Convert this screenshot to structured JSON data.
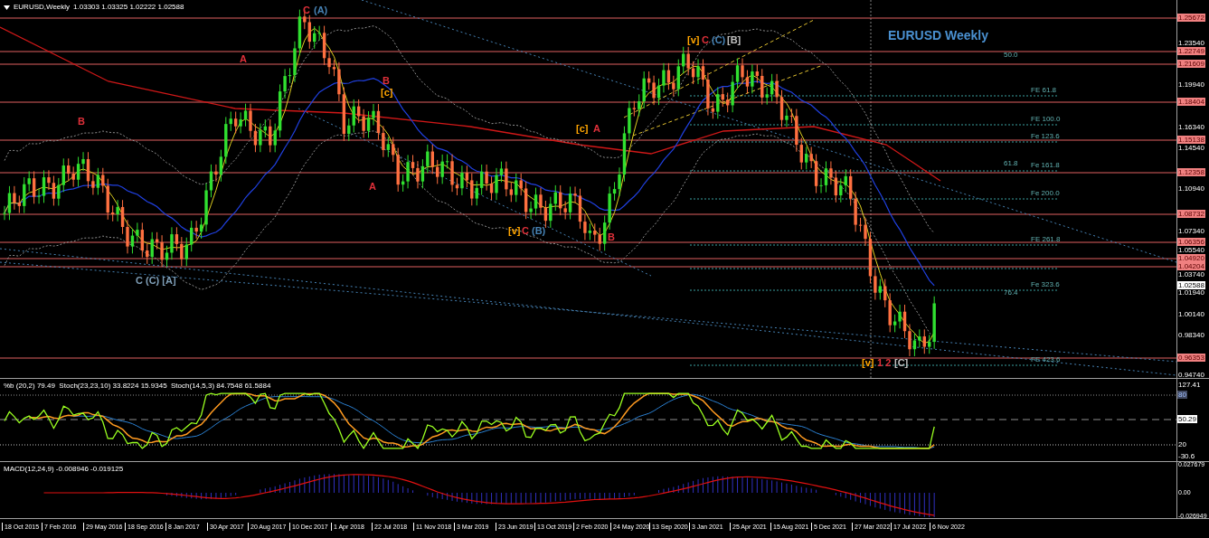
{
  "header": {
    "symbol": "EURUSD,Weekly",
    "ohlc": "1.03303 1.03325 1.02222 1.02588"
  },
  "chart_title": "EURUSD Weekly",
  "price_axis": {
    "ticks": [
      "1.23540",
      "1.19940",
      "1.16340",
      "1.14540",
      "1.10940",
      "1.07340",
      "1.05540",
      "1.03740",
      "1.01940",
      "1.00140",
      "0.98340",
      "0.94740"
    ],
    "levels": [
      "1.25672",
      "1.22749",
      "1.21609",
      "1.18404",
      "1.15138",
      "1.12358",
      "1.08732",
      "1.06356",
      "1.04920",
      "1.04204",
      "0.96353"
    ],
    "current_price": "1.02588"
  },
  "fib_labels": [
    "50.0",
    "FE 61.8",
    "FE 100.0",
    "Fe 123.6",
    "61.8",
    "Fe 161.8",
    "Fe 200.0",
    "FE 261.8",
    "Fe 323.6",
    "76.4",
    "FE 423.6"
  ],
  "wave_labels": [
    {
      "text": "C",
      "color": "#e0303a"
    },
    {
      "text": "(A)",
      "color": "#4682b4"
    },
    {
      "text": "A",
      "color": "#e0303a"
    },
    {
      "text": "B",
      "color": "#e0303a"
    },
    {
      "text": "B",
      "color": "#e0303a"
    },
    {
      "text": "[c]",
      "color": "#ffa500"
    },
    {
      "text": "A",
      "color": "#e0303a"
    },
    {
      "text": "C (C) [A]",
      "color": "#7f9fb8"
    },
    {
      "text": "[v]",
      "color": "#ffa500"
    },
    {
      "text": "C",
      "color": "#e0303a"
    },
    {
      "text": "(B)",
      "color": "#4682b4"
    },
    {
      "text": "[c]",
      "color": "#ffa500"
    },
    {
      "text": "A",
      "color": "#e0303a"
    },
    {
      "text": "B",
      "color": "#e0303a"
    },
    {
      "text": "[v]",
      "color": "#ffa500"
    },
    {
      "text": "C",
      "color": "#e0303a"
    },
    {
      "text": "(C)",
      "color": "#4682b4"
    },
    {
      "text": "[B]",
      "color": "#c0c0c0"
    },
    {
      "text": "[v]",
      "color": "#ffa500"
    },
    {
      "text": "1 2",
      "color": "#e0303a"
    },
    {
      "text": "[C]",
      "color": "#c0c0c0"
    }
  ],
  "oscillator": {
    "legend": "%b (20,2) 79.49  Stoch(23,23,10) 33.8224 15.9345  Stoch(14,5,3) 84.7548 61.5884",
    "ticks": [
      "127.41",
      "20",
      "-30.6"
    ],
    "boxed_ticks": [
      "80",
      "50.29"
    ]
  },
  "macd": {
    "legend": "MACD(12,24,9) -0.008946 -0.019125",
    "ticks": [
      "0.027679",
      "0.00",
      "-0.026949"
    ]
  },
  "date_axis": [
    "18 Oct 2015",
    "7 Feb 2016",
    "29 May 2016",
    "18 Sep 2016",
    "8 Jan 2017",
    "30 Apr 2017",
    "20 Aug 2017",
    "10 Dec 2017",
    "1 Apr 2018",
    "22 Jul 2018",
    "11 Nov 2018",
    "3 Mar 2019",
    "23 Jun 2019",
    "13 Oct 2019",
    "2 Feb 2020",
    "24 May 2020",
    "13 Sep 2020",
    "3 Jan 2021",
    "25 Apr 2021",
    "15 Aug 2021",
    "5 Dec 2021",
    "27 Mar 2022",
    "17 Jul 2022",
    "6 Nov 2022"
  ]
}
